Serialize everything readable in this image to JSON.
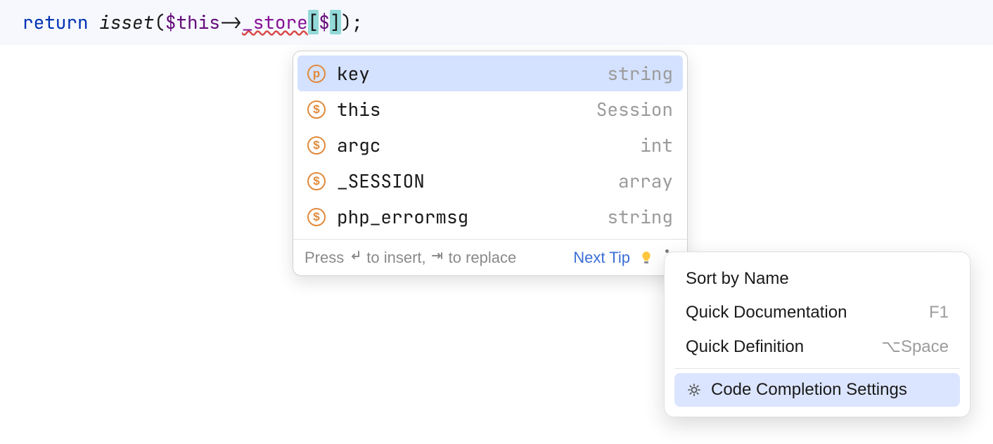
{
  "code": {
    "return_kw": "return",
    "isset_fn": "isset",
    "open_paren": "(",
    "this_var": "$this",
    "arrow": "->",
    "member": "_store",
    "lbracket": "[",
    "dollar": "$",
    "rbracket": "]",
    "close": ");"
  },
  "completion": {
    "items": [
      {
        "icon": "p",
        "name": "key",
        "type": "string",
        "selected": true
      },
      {
        "icon": "s",
        "name": "this",
        "type": "Session",
        "selected": false
      },
      {
        "icon": "s",
        "name": "argc",
        "type": "int",
        "selected": false
      },
      {
        "icon": "s",
        "name": "_SESSION",
        "type": "array",
        "selected": false
      },
      {
        "icon": "s",
        "name": "php_errormsg",
        "type": "string",
        "selected": false
      }
    ],
    "hint_press": "Press ",
    "hint_insert": " to insert, ",
    "hint_replace": " to replace",
    "next_tip": "Next Tip"
  },
  "contextMenu": {
    "items": [
      {
        "label": "Sort by Name",
        "shortcut": ""
      },
      {
        "label": "Quick Documentation",
        "shortcut": "F1"
      },
      {
        "label": "Quick Definition",
        "shortcut": "⌥Space"
      }
    ],
    "settings": {
      "label": "Code Completion Settings"
    }
  }
}
